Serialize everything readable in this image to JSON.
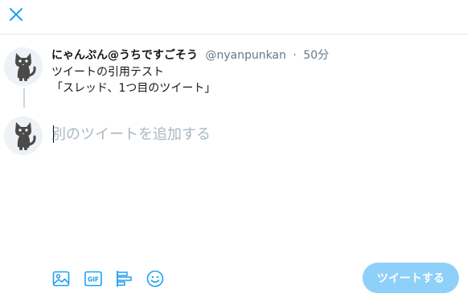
{
  "colors": {
    "accent": "#1da1f2",
    "button_disabled": "#8ed0f9",
    "muted": "#657786",
    "placeholder": "#aab8c2"
  },
  "header": {
    "close_icon": "close-icon"
  },
  "tweet": {
    "author_name": "にゃんぷん@うちですごそう",
    "handle": "@nyanpunkan",
    "separator": "·",
    "time": "50分",
    "lines": [
      "ツイートの引用テスト",
      "「スレッド、1つ目のツイート」"
    ]
  },
  "compose": {
    "placeholder": "別のツイートを追加する",
    "value": ""
  },
  "toolbar": {
    "icons": [
      "image-icon",
      "gif-icon",
      "poll-icon",
      "emoji-icon"
    ],
    "gif_label": "GIF",
    "tweet_button": "ツイートする"
  }
}
